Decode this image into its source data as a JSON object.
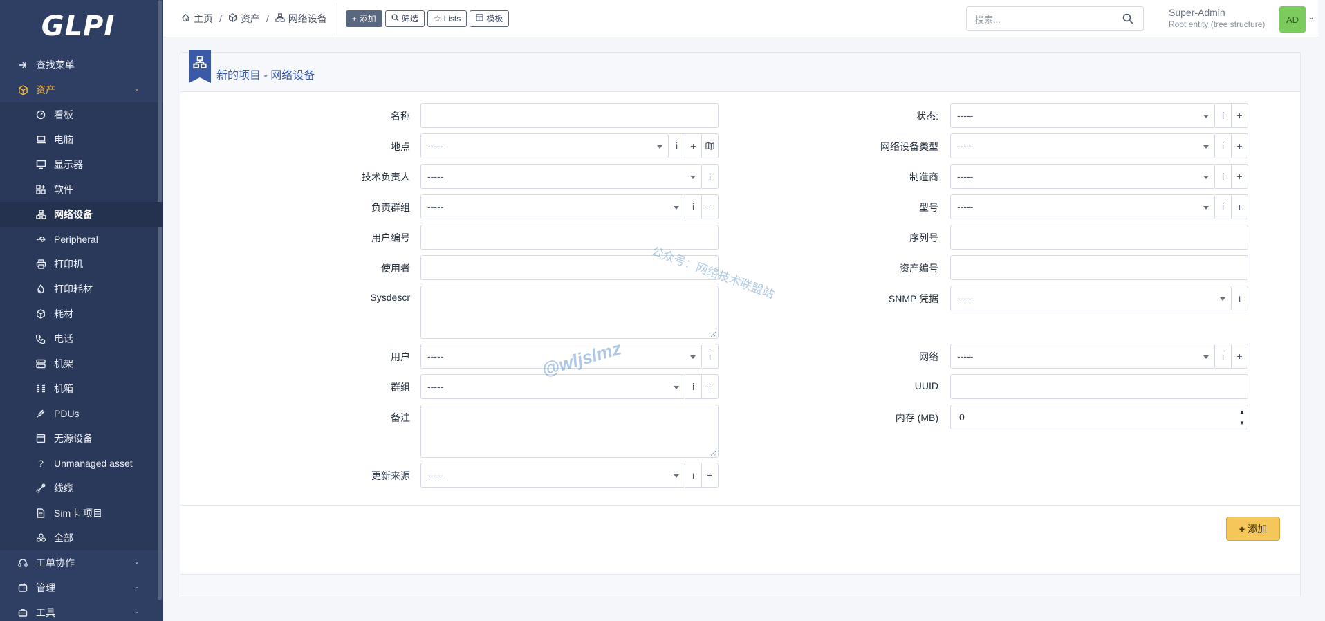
{
  "app": {
    "logo": "GLPI"
  },
  "sidebar": {
    "find_menu": "查找菜单",
    "assets_section": "资产",
    "asset_items": [
      {
        "label": "看板",
        "icon": "dashboard-icon"
      },
      {
        "label": "电脑",
        "icon": "laptop-icon"
      },
      {
        "label": "显示器",
        "icon": "monitor-icon"
      },
      {
        "label": "软件",
        "icon": "apps-icon"
      },
      {
        "label": "网络设备",
        "icon": "network-icon"
      },
      {
        "label": "Peripheral",
        "icon": "usb-icon"
      },
      {
        "label": "打印机",
        "icon": "printer-icon"
      },
      {
        "label": "打印耗材",
        "icon": "droplet-icon"
      },
      {
        "label": "耗材",
        "icon": "package-icon"
      },
      {
        "label": "电话",
        "icon": "phone-icon"
      },
      {
        "label": "机架",
        "icon": "server-icon"
      },
      {
        "label": "机箱",
        "icon": "columns-icon"
      },
      {
        "label": "PDUs",
        "icon": "plug-icon"
      },
      {
        "label": "无源设备",
        "icon": "box-icon"
      },
      {
        "label": "Unmanaged asset",
        "icon": "question-icon"
      },
      {
        "label": "线缆",
        "icon": "cable-icon"
      },
      {
        "label": "Sim卡 项目",
        "icon": "simcard-icon"
      },
      {
        "label": "全部",
        "icon": "stack-icon"
      }
    ],
    "other_sections": [
      {
        "label": "工单协作",
        "icon": "headset-icon"
      },
      {
        "label": "管理",
        "icon": "wallet-icon"
      },
      {
        "label": "工具",
        "icon": "briefcase-icon"
      }
    ]
  },
  "header": {
    "breadcrumb": [
      "主页",
      "资产",
      "网络设备"
    ],
    "buttons": {
      "add": "添加",
      "filter": "筛选",
      "lists": "Lists",
      "templates": "模板"
    },
    "search_placeholder": "搜索...",
    "user_name": "Super-Admin",
    "user_entity": "Root entity (tree structure)",
    "avatar": "AD"
  },
  "form": {
    "title": "新的项目 - 网络设备",
    "placeholder_dropdown": "-----",
    "left": {
      "name": "名称",
      "location": "地点",
      "tech_in_charge": "技术负责人",
      "group_in_charge": "负责群组",
      "user_number": "用户编号",
      "user_alt": "使用者",
      "sysdescr": "Sysdescr",
      "user": "用户",
      "group": "群组",
      "comment": "备注",
      "update_source": "更新来源"
    },
    "right": {
      "status": "状态:",
      "type": "网络设备类型",
      "manufacturer": "制造商",
      "model": "型号",
      "serial": "序列号",
      "inventory": "资产编号",
      "snmp": "SNMP 凭据",
      "network": "网络",
      "uuid": "UUID",
      "memory": "内存 (MB)",
      "memory_value": "0"
    },
    "submit": "添加",
    "btn_info": "i",
    "btn_plus": "+"
  },
  "watermarks": {
    "line1": "公众号：网络技术联盟站",
    "line2": "@wljslmz"
  },
  "colors": {
    "sidebar_bg": "#2f3f64",
    "accent": "#f5b335",
    "primary": "#3a5aa8",
    "submit": "#f5c65a",
    "avatar": "#7ccc5d"
  }
}
